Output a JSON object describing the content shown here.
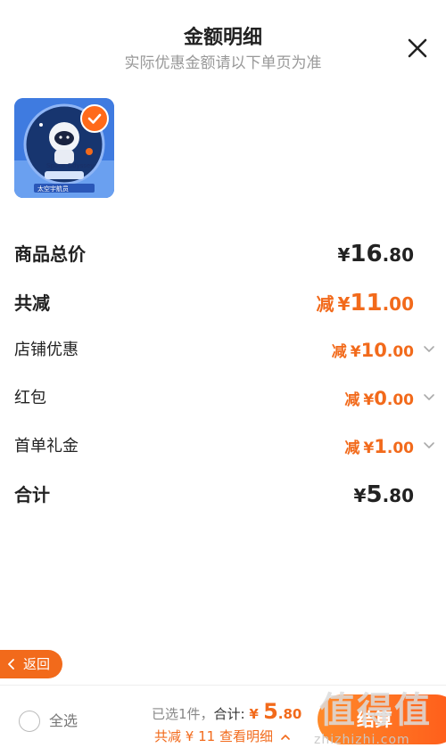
{
  "header": {
    "title": "金额明细",
    "subtitle": "实际优惠金额请以下单页为准"
  },
  "product": {
    "badge_text": "Space Odyssey",
    "caption": "太空宇航员"
  },
  "rows": {
    "total": {
      "label": "商品总价",
      "currency": "¥",
      "int": "16",
      "dec": ".80"
    },
    "discount": {
      "label": "共减",
      "prefix": "减",
      "currency": "¥",
      "int": "11",
      "dec": ".00"
    },
    "store": {
      "label": "店铺优惠",
      "prefix": "减",
      "currency": "¥",
      "int": "10",
      "dec": ".00"
    },
    "redpacket": {
      "label": "红包",
      "prefix": "减",
      "currency": "¥",
      "int": "0",
      "dec": ".00"
    },
    "firstorder": {
      "label": "首单礼金",
      "prefix": "减",
      "currency": "¥",
      "int": "1",
      "dec": ".00"
    },
    "sum": {
      "label": "合计",
      "currency": "¥",
      "int": "5",
      "dec": ".80"
    }
  },
  "back": {
    "label": "返回"
  },
  "footer": {
    "select_all": "全选",
    "selected": "已选1件，",
    "total_label": "合计:",
    "total_currency": "¥",
    "total_int": "5",
    "total_dec": ".80",
    "reduced_text": "共减 ¥ 11",
    "detail_link": "查看明细",
    "checkout": "结算"
  },
  "watermark": {
    "big": "值得值",
    "small": "zhizhizhi.com"
  },
  "colors": {
    "accent": "#f26a1b",
    "text": "#222222",
    "muted": "#999999"
  }
}
